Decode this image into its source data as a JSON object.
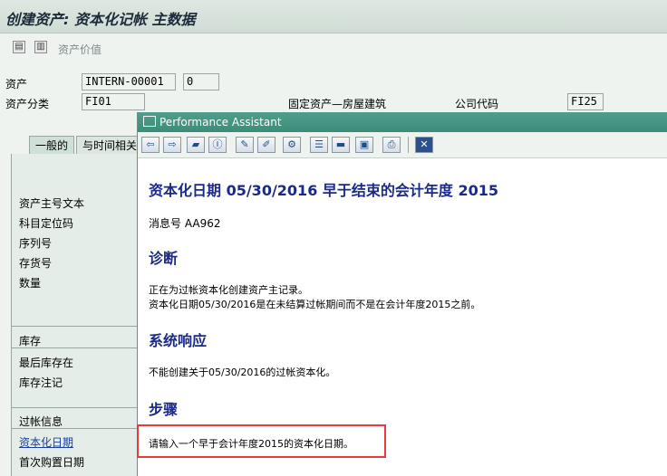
{
  "window": {
    "title": "创建资产: 资本化记帐 主数据"
  },
  "toolbar": {
    "asset_value_label": "资产价值"
  },
  "header": {
    "asset_label": "资产",
    "asset_value": "INTERN-00001",
    "asset_sub_value": "0",
    "class_label": "资产分类",
    "class_value": "FI01",
    "class_desc": "固定资产—房屋建筑",
    "company_label": "公司代码",
    "company_value": "FI25"
  },
  "tabs": [
    {
      "label": "一般的"
    },
    {
      "label": "与时间相关"
    }
  ],
  "left_panel": {
    "items": [
      "资产主号文本",
      "科目定位码",
      "序列号",
      "存货号",
      "数量"
    ],
    "inventory_section": "库存",
    "inventory_items": [
      "最后库存在",
      "库存注记"
    ],
    "posting_section": "过帐信息",
    "posting_items": [
      "资本化日期",
      "首次购置日期"
    ]
  },
  "popup": {
    "title": "Performance Assistant",
    "message_title": "资本化日期  05/30/2016 早于结束的会计年度  2015",
    "message_number": "消息号  AA962",
    "diagnosis_heading": "诊断",
    "diagnosis_lines": [
      "正在为过帐资本化创建资产主记录。",
      "资本化日期05/30/2016是在未结算过帐期间而不是在会计年度2015之前。"
    ],
    "system_response_heading": "系统响应",
    "system_response_line": "不能创建关于05/30/2016的过帐资本化。",
    "procedure_heading": "步骤",
    "procedure_line": "请输入一个早于会计年度2015的资本化日期。"
  },
  "colors": {
    "title_bar": "#3b8d79",
    "heading": "#1b2a86",
    "highlight": "#e53b3b"
  }
}
